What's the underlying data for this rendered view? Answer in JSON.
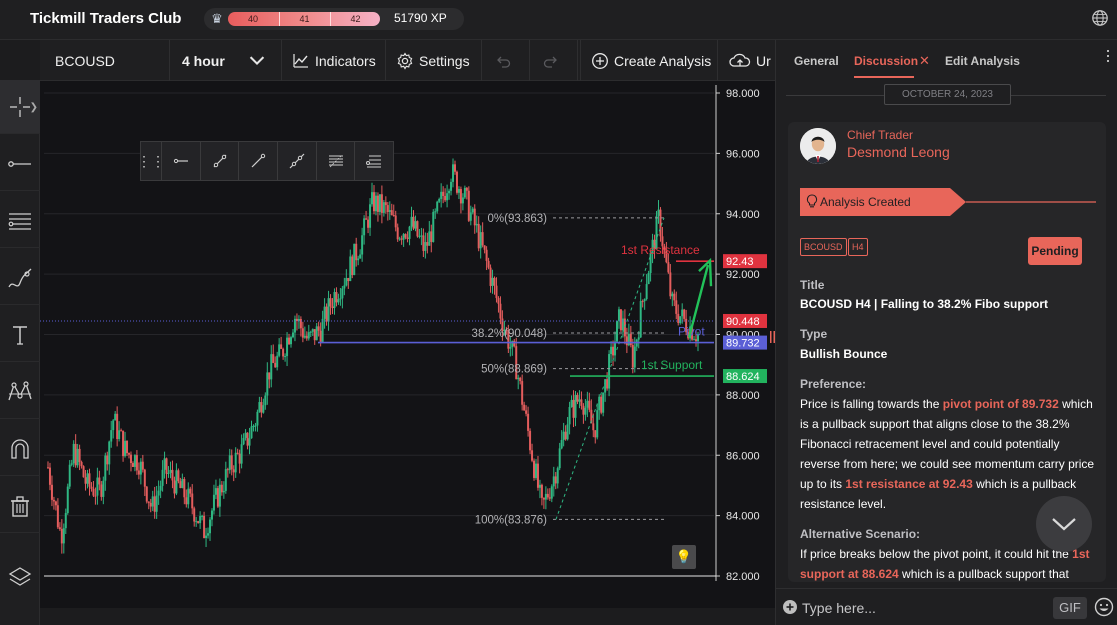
{
  "app": {
    "title": "Tickmill Traders Club",
    "xp_levels": [
      "40",
      "41",
      "42"
    ],
    "xp_text": "51790 XP"
  },
  "toolbar": {
    "symbol": "BCOUSD",
    "timeframe": "4 hour",
    "indicators_label": "Indicators",
    "settings_label": "Settings",
    "create_label": "Create Analysis",
    "truncated_label": "Ur"
  },
  "left_tools": [
    "crosshair-icon",
    "line-icon",
    "parallel-lines-icon",
    "brush-icon",
    "text-icon",
    "pattern-icon",
    "magnet-icon",
    "trash-icon",
    "layers-icon"
  ],
  "drawbar_tools": [
    "horizontal-line-icon",
    "ray-icon",
    "trend-line-icon",
    "extended-line-icon",
    "parallel-channel-icon",
    "fib-icon"
  ],
  "chart_data": {
    "type": "candlestick",
    "instrument": "BCOUSD",
    "timeframe": "4 hour",
    "y_axis_ticks": [
      "98.000",
      "96.000",
      "94.000",
      "92.000",
      "90.000",
      "88.000",
      "86.000",
      "84.000",
      "82.000"
    ],
    "ylim": [
      82,
      98
    ],
    "close_path": [
      [
        0,
        85.6
      ],
      [
        0.02,
        83.3
      ],
      [
        0.04,
        86.2
      ],
      [
        0.06,
        85.0
      ],
      [
        0.08,
        84.8
      ],
      [
        0.1,
        87.2
      ],
      [
        0.12,
        86.1
      ],
      [
        0.14,
        85.8
      ],
      [
        0.16,
        84.2
      ],
      [
        0.18,
        85.5
      ],
      [
        0.2,
        85.0
      ],
      [
        0.22,
        84.4
      ],
      [
        0.24,
        83.5
      ],
      [
        0.26,
        84.6
      ],
      [
        0.28,
        85.6
      ],
      [
        0.3,
        86.2
      ],
      [
        0.32,
        87.2
      ],
      [
        0.34,
        88.8
      ],
      [
        0.36,
        89.4
      ],
      [
        0.38,
        90.6
      ],
      [
        0.4,
        89.8
      ],
      [
        0.42,
        90.2
      ],
      [
        0.44,
        91.3
      ],
      [
        0.46,
        92.0
      ],
      [
        0.48,
        93.0
      ],
      [
        0.5,
        94.4
      ],
      [
        0.52,
        94.1
      ],
      [
        0.54,
        93.4
      ],
      [
        0.56,
        93.6
      ],
      [
        0.58,
        92.8
      ],
      [
        0.6,
        94.1
      ],
      [
        0.62,
        95.4
      ],
      [
        0.64,
        94.6
      ],
      [
        0.66,
        93.4
      ],
      [
        0.68,
        92.0
      ],
      [
        0.7,
        90.4
      ],
      [
        0.72,
        89.0
      ],
      [
        0.74,
        86.6
      ],
      [
        0.76,
        84.2
      ],
      [
        0.78,
        85.4
      ],
      [
        0.8,
        87.3
      ],
      [
        0.82,
        88.0
      ],
      [
        0.84,
        86.8
      ],
      [
        0.86,
        88.6
      ],
      [
        0.88,
        90.6
      ],
      [
        0.9,
        89.2
      ],
      [
        0.92,
        91.8
      ],
      [
        0.94,
        93.9
      ],
      [
        0.96,
        91.0
      ],
      [
        0.98,
        90.4
      ],
      [
        1.0,
        90.0
      ]
    ],
    "levels": [
      {
        "name": "1st Resistance",
        "value": 92.43,
        "label": "92.43",
        "color": "#e8384f"
      },
      {
        "name": "Pivot",
        "value": 89.732,
        "label": "89.732",
        "color": "#5b5fd6"
      },
      {
        "name": "1st Support",
        "value": 88.624,
        "label": "88.624",
        "color": "#22a95b"
      },
      {
        "name": "current",
        "value": 90.448,
        "label": "90.448",
        "color": "#e8384f"
      }
    ],
    "fibonacci": [
      {
        "label": "0%(93.863)",
        "value": 93.863
      },
      {
        "label": "38.2%(90.048)",
        "value": 90.048
      },
      {
        "label": "50%(88.869)",
        "value": 88.869
      },
      {
        "label": "100%(83.876)",
        "value": 83.876
      }
    ],
    "annotations": [
      "1st Resistance",
      "Pivot",
      "1st Support"
    ]
  },
  "panel": {
    "tabs": [
      "General",
      "Discussion",
      "Edit Analysis"
    ],
    "date": "OCTOBER 24, 2023",
    "author_role": "Chief Trader",
    "author_name": "Desmond Leong",
    "banner": "Analysis Created",
    "tags": [
      "BCOUSD",
      "H4"
    ],
    "status": "Pending",
    "title_label": "Title",
    "title_value": "BCOUSD H4 | Falling to 38.2% Fibo support",
    "type_label": "Type",
    "type_value": "Bullish Bounce",
    "pref_label": "Preference:",
    "pref_a": "Price is falling towards the ",
    "pref_hl1": "pivot point of 89.732",
    "pref_b": " which is a pullback support that aligns close to the 38.2% Fibonacci retracement level and could potentially reverse from here; we could see momentum carry price up to its ",
    "pref_hl2": "1st resistance at 92.43",
    "pref_c": " which is a pullback resistance level.",
    "alt_label": "Alternative Scenario:",
    "alt_a": "If price breaks below the pivot point, it could hit the ",
    "alt_hl": "1st support at 88.624",
    "alt_b": " which is a pullback support that",
    "input_placeholder": "Type here...",
    "gif_label": "GIF"
  }
}
